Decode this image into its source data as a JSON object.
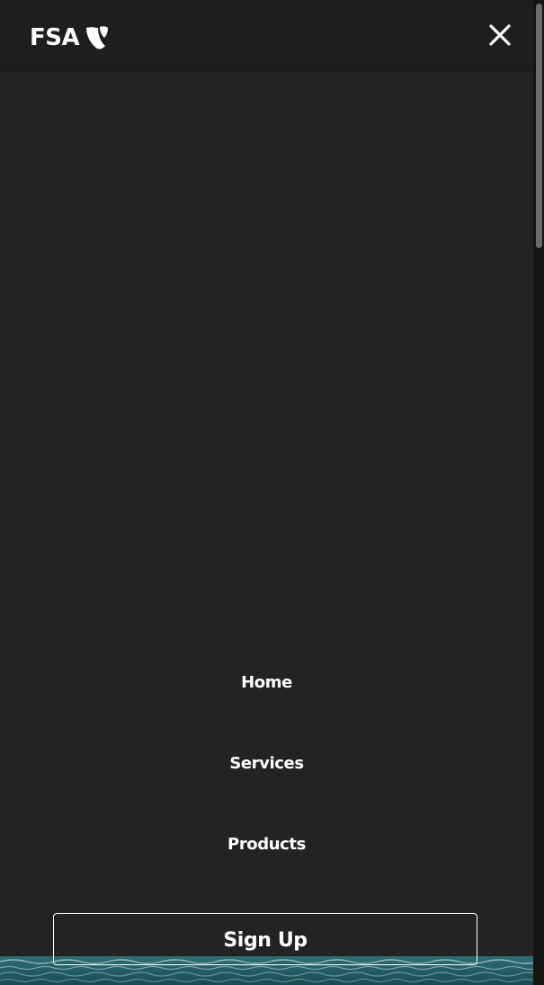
{
  "header": {
    "logo_text": "FSA",
    "logo_icon": "typo3-shield-icon",
    "close_icon": "close-icon"
  },
  "menu": {
    "items": [
      {
        "label": "Home"
      },
      {
        "label": "Services"
      },
      {
        "label": "Products"
      }
    ],
    "cta_label": "Sign Up"
  },
  "colors": {
    "background": "#242323",
    "header_background": "#1e1e1e",
    "text": "#ffffff",
    "water_teal": "#1f5f66"
  }
}
